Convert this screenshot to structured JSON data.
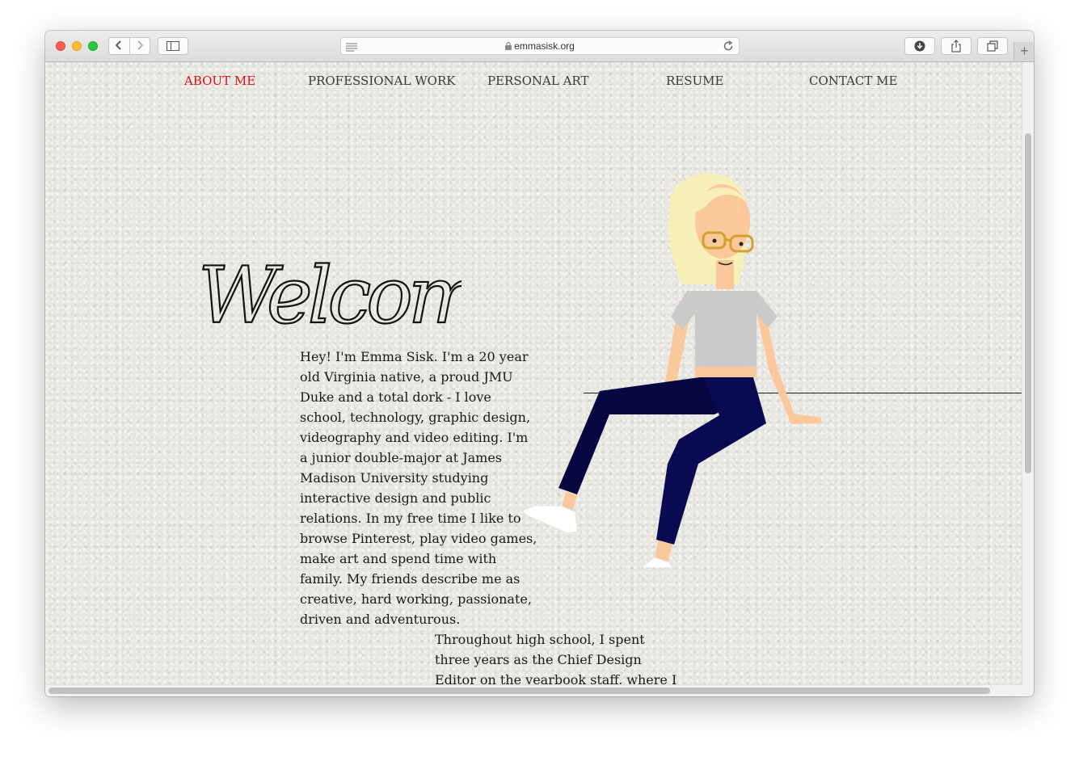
{
  "browser": {
    "url": "emmasisk.org",
    "new_tab_label": "+"
  },
  "nav": {
    "items": [
      {
        "label": "ABOUT ME",
        "active": true
      },
      {
        "label": "PROFESSIONAL WORK",
        "active": false
      },
      {
        "label": "PERSONAL ART",
        "active": false
      },
      {
        "label": "RESUME",
        "active": false
      },
      {
        "label": "CONTACT ME",
        "active": false
      }
    ],
    "active_color": "#e01010"
  },
  "hero": {
    "heading": "Welcome!"
  },
  "bio": {
    "paragraph_1": "Hey! I'm Emma Sisk. I'm a 20 year old Virginia native, a proud JMU Duke and a total dork - I love school, technology, graphic design, videography and video editing. I'm a junior double-major at James Madison University studying interactive design and public relations. In my free time I like to browse Pinterest, play video games, make art and spend time with family. My friends describe me as creative, hard working, passionate, driven and adventurous.",
    "paragraph_2": "Throughout high school, I spent three years as the Chief Design Editor on the yearbook staff, where I developed my passion for graphic/print publication design. My passion for"
  },
  "colors": {
    "hair": "#f7efb8",
    "skin": "#fbc89b",
    "shirt": "#cacaca",
    "pants": "#0a0a52",
    "glasses": "#d1a12b"
  },
  "icons": [
    "back-icon",
    "forward-icon",
    "sidebar-icon",
    "reader-icon",
    "lock-icon",
    "reload-icon",
    "download-icon",
    "share-icon",
    "tabs-icon"
  ]
}
